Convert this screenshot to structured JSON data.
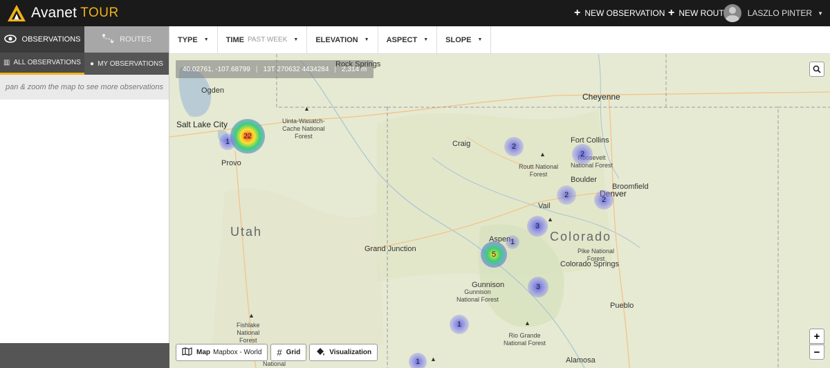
{
  "app": {
    "name": "Avanet",
    "name_suffix": "TOUR"
  },
  "header": {
    "new_observation": "NEW OBSERVATION",
    "new_route": "NEW ROUTE",
    "user_name": "LASZLO PINTER"
  },
  "sidebar": {
    "tabs": [
      {
        "label": "OBSERVATIONS",
        "icon": "eye-icon"
      },
      {
        "label": "ROUTES",
        "icon": "route-icon"
      }
    ],
    "subtabs": [
      {
        "label": "ALL OBSERVATIONS",
        "icon": "map-icon"
      },
      {
        "label": "MY OBSERVATIONS",
        "icon": "user-icon"
      }
    ],
    "hint": "pan & zoom the map to see more observations"
  },
  "filters": {
    "type": "TYPE",
    "time": "TIME",
    "time_value": "PAST WEEK",
    "elevation": "ELEVATION",
    "aspect": "ASPECT",
    "slope": "SLOPE"
  },
  "map": {
    "coord_latlon": "40.02761, -107.68799",
    "coord_utm": "13T 270632 4434284",
    "coord_elev": "2,314 m",
    "labels": {
      "rock_springs": "Rock Springs",
      "ogden": "Ogden",
      "salt_lake_city": "Salt Lake City",
      "uinta": "Uinta-Wasatch-\nCache National\nForest",
      "provo": "Provo",
      "cheyenne": "Cheyenne",
      "craig": "Craig",
      "fort_collins": "Fort Collins",
      "routt": "Routt National\nForest",
      "roosevelt": "Roosevelt\nNational Forest",
      "boulder": "Boulder",
      "broomfield": "Broomfield",
      "denver": "Denver",
      "vail": "Vail",
      "utah": "Utah",
      "colorado": "Colorado",
      "grand_junction": "Grand Junction",
      "aspen": "Aspen",
      "pike": "Pike National\nForest",
      "colorado_springs": "Colorado Springs",
      "gunnison": "Gunnison",
      "gunnison_nf": "Gunnison\nNational Forest",
      "pueblo": "Pueblo",
      "fishlake": "Fishlake\nNational\nForest",
      "rio_grande": "Rio Grande\nNational Forest",
      "alamosa": "Alamosa",
      "national": "National"
    },
    "clusters": [
      {
        "count": "22",
        "intensity": "high"
      },
      {
        "count": "1",
        "intensity": "low"
      },
      {
        "count": "2",
        "intensity": "low"
      },
      {
        "count": "2",
        "intensity": "low"
      },
      {
        "count": "2",
        "intensity": "low"
      },
      {
        "count": "2",
        "intensity": "low"
      },
      {
        "count": "3",
        "intensity": "low"
      },
      {
        "count": "1",
        "intensity": "low"
      },
      {
        "count": "5",
        "intensity": "medium"
      },
      {
        "count": "3",
        "intensity": "low"
      },
      {
        "count": "1",
        "intensity": "low"
      },
      {
        "count": "1",
        "intensity": "low"
      }
    ],
    "tools": {
      "map_label": "Map",
      "map_source": "Mapbox - World",
      "grid_label": "Grid",
      "viz_label": "Visualization"
    },
    "zoom_in": "+",
    "zoom_out": "−"
  },
  "colors": {
    "accent": "#f0b21a",
    "topbar": "#1a1a1a",
    "map_bg": "#e9ecd6"
  }
}
